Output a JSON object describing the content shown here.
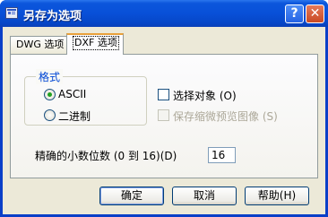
{
  "window": {
    "title": "另存为选项",
    "help_label": "?",
    "close_label": "✕"
  },
  "tabs": [
    {
      "label": "DWG 选项",
      "selected": false
    },
    {
      "label": "DXF 选项",
      "selected": true
    }
  ],
  "format_group": {
    "title": "格式",
    "options": [
      {
        "label": "ASCII",
        "selected": true
      },
      {
        "label": "二进制",
        "selected": false
      }
    ]
  },
  "options": {
    "select_objects": {
      "label": "选择对象 (O)",
      "checked": false,
      "enabled": true
    },
    "save_thumbnail": {
      "label": "保存缩微预览图像 (S)",
      "checked": false,
      "enabled": false
    }
  },
  "precision": {
    "label": "精确的小数位数 (0 到 16)(D)",
    "value": "16"
  },
  "buttons": {
    "ok": "确定",
    "cancel": "取消",
    "help": "帮助(H)"
  },
  "colors": {
    "titlebar": "#0850d8",
    "dialog_face": "#ece9d8",
    "group_title": "#0046d5",
    "radio_dot": "#21a121"
  }
}
